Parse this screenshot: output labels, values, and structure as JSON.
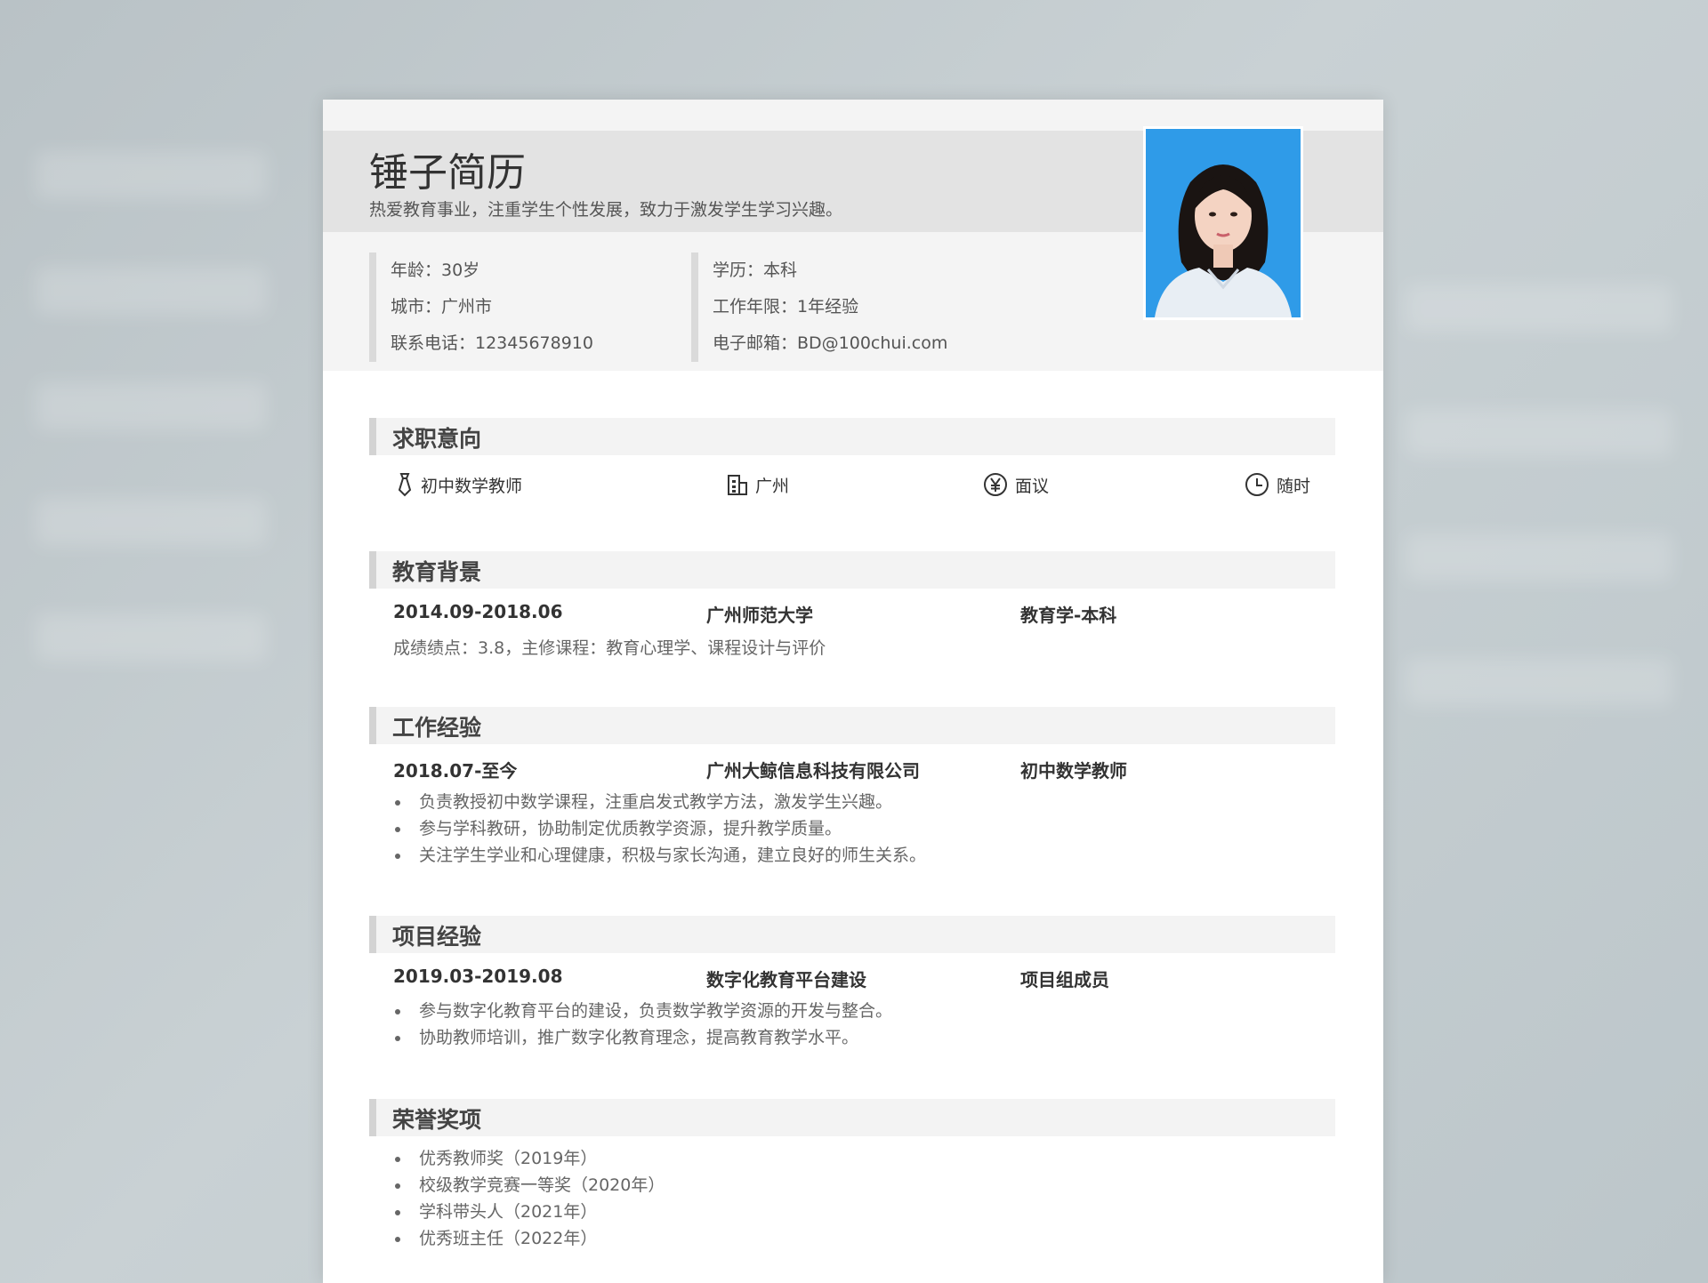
{
  "header": {
    "name": "锤子简历",
    "motto": "热爱教育事业，注重学生个性发展，致力于激发学生学习兴趣。"
  },
  "info": {
    "left": [
      "年龄：30岁",
      "城市：广州市",
      "联系电话：12345678910"
    ],
    "right": [
      "学历：本科",
      "工作年限：1年经验",
      "电子邮箱：BD@100chui.com"
    ]
  },
  "sections": {
    "intent": {
      "title": "求职意向",
      "items": [
        {
          "icon": "tie-icon",
          "label": "初中数学教师"
        },
        {
          "icon": "building-icon",
          "label": "广州"
        },
        {
          "icon": "yen-icon",
          "label": "面议"
        },
        {
          "icon": "clock-icon",
          "label": "随时"
        }
      ]
    },
    "education": {
      "title": "教育背景",
      "period": "2014.09-2018.06",
      "school": "广州师范大学",
      "degree": "教育学-本科",
      "desc": "成绩绩点：3.8，主修课程：教育心理学、课程设计与评价"
    },
    "work": {
      "title": "工作经验",
      "period": "2018.07-至今",
      "company": "广州大鲸信息科技有限公司",
      "position": "初中数学教师",
      "bullets": [
        "负责教授初中数学课程，注重启发式教学方法，激发学生兴趣。",
        "参与学科教研，协助制定优质教学资源，提升教学质量。",
        "关注学生学业和心理健康，积极与家长沟通，建立良好的师生关系。"
      ]
    },
    "project": {
      "title": "项目经验",
      "period": "2019.03-2019.08",
      "name": "数字化教育平台建设",
      "role": "项目组成员",
      "bullets": [
        "参与数字化教育平台的建设，负责数学教学资源的开发与整合。",
        "协助教师培训，推广数字化教育理念，提高教育教学水平。"
      ]
    },
    "honors": {
      "title": "荣誉奖项",
      "bullets": [
        "优秀教师奖（2019年）",
        "校级教学竞赛一等奖（2020年）",
        "学科带头人（2021年）",
        "优秀班主任（2022年）"
      ]
    }
  }
}
